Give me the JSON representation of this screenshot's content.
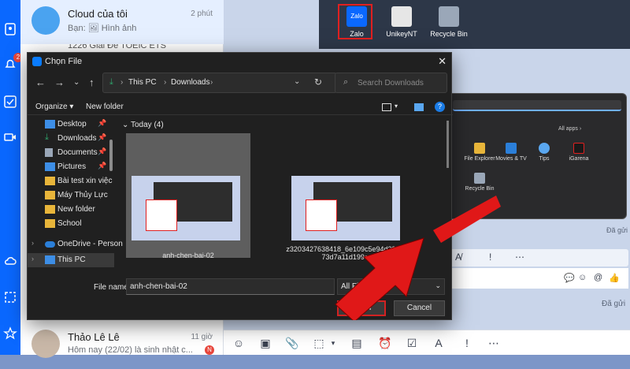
{
  "zalo": {
    "badge_count": "2",
    "conversations": [
      {
        "name": "Cloud của tôi",
        "time": "2 phút",
        "sub": "Bạn: 🖼 Hình ảnh"
      },
      {
        "name": "",
        "time": "",
        "sub": ""
      },
      {
        "name": "Thảo Lê Lê",
        "time": "11 giờ",
        "sub": "Hôm nay (22/02) là sinh nhật c...",
        "badge": "N"
      }
    ],
    "partial_top_text": "1226 Giải Đề TOEIC ETS",
    "sent_status_1": "Đã gửi",
    "sent_status_2": "Đã gửi"
  },
  "desktop": {
    "icons": [
      {
        "label": "Zalo",
        "icon": "zalo-icon"
      },
      {
        "label": "UnikeyNT",
        "icon": "unikey-icon"
      },
      {
        "label": "Recycle Bin",
        "icon": "recycle-bin-icon"
      }
    ],
    "start_menu": {
      "all_apps": "All apps ›",
      "apps": [
        "File Explorer",
        "Movies & TV",
        "Tips",
        "iGarena",
        "Recycle Bin"
      ]
    }
  },
  "dialog": {
    "title": "Chọn File",
    "breadcrumb": [
      "This PC",
      "Downloads"
    ],
    "search_placeholder": "Search Downloads",
    "organize": "Organize ▾",
    "new_folder": "New folder",
    "nav_items": [
      {
        "label": "Desktop",
        "pinned": true,
        "icon": "desktop-icon",
        "color": "#3d8ee6"
      },
      {
        "label": "Downloads",
        "pinned": true,
        "icon": "download-icon",
        "color": "#2fa36b"
      },
      {
        "label": "Documents",
        "pinned": true,
        "icon": "documents-icon",
        "color": "#9aa7b8"
      },
      {
        "label": "Pictures",
        "pinned": true,
        "icon": "pictures-icon",
        "color": "#3d8ee6"
      },
      {
        "label": "Bài test xin việc",
        "pinned": false,
        "icon": "folder-icon",
        "color": "#e8b53a"
      },
      {
        "label": "Máy Thủy Lực",
        "pinned": false,
        "icon": "folder-icon",
        "color": "#e8b53a"
      },
      {
        "label": "New folder",
        "pinned": false,
        "icon": "folder-icon",
        "color": "#e8b53a"
      },
      {
        "label": "School",
        "pinned": false,
        "icon": "folder-icon",
        "color": "#e8b53a"
      },
      {
        "label": "OneDrive - Person",
        "pinned": false,
        "icon": "onedrive-icon",
        "color": "#2b7fd9"
      },
      {
        "label": "This PC",
        "pinned": false,
        "icon": "this-pc-icon",
        "color": "#3d8ee6"
      }
    ],
    "group_header": "Today (4)",
    "files": [
      {
        "name": "anh-chen-bai-02"
      },
      {
        "name": "z3203427638418_6e109c5e94d39e173d7a11d199c"
      }
    ],
    "file_name_label": "File name:",
    "file_name_value": "anh-chen-bai-02",
    "file_type_value": "All Files",
    "open_label": "Open",
    "cancel_label": "Cancel"
  },
  "colors": {
    "zalo_blue": "#0a68ff",
    "dialog_bg": "#202020",
    "highlight_red": "#d32222"
  }
}
